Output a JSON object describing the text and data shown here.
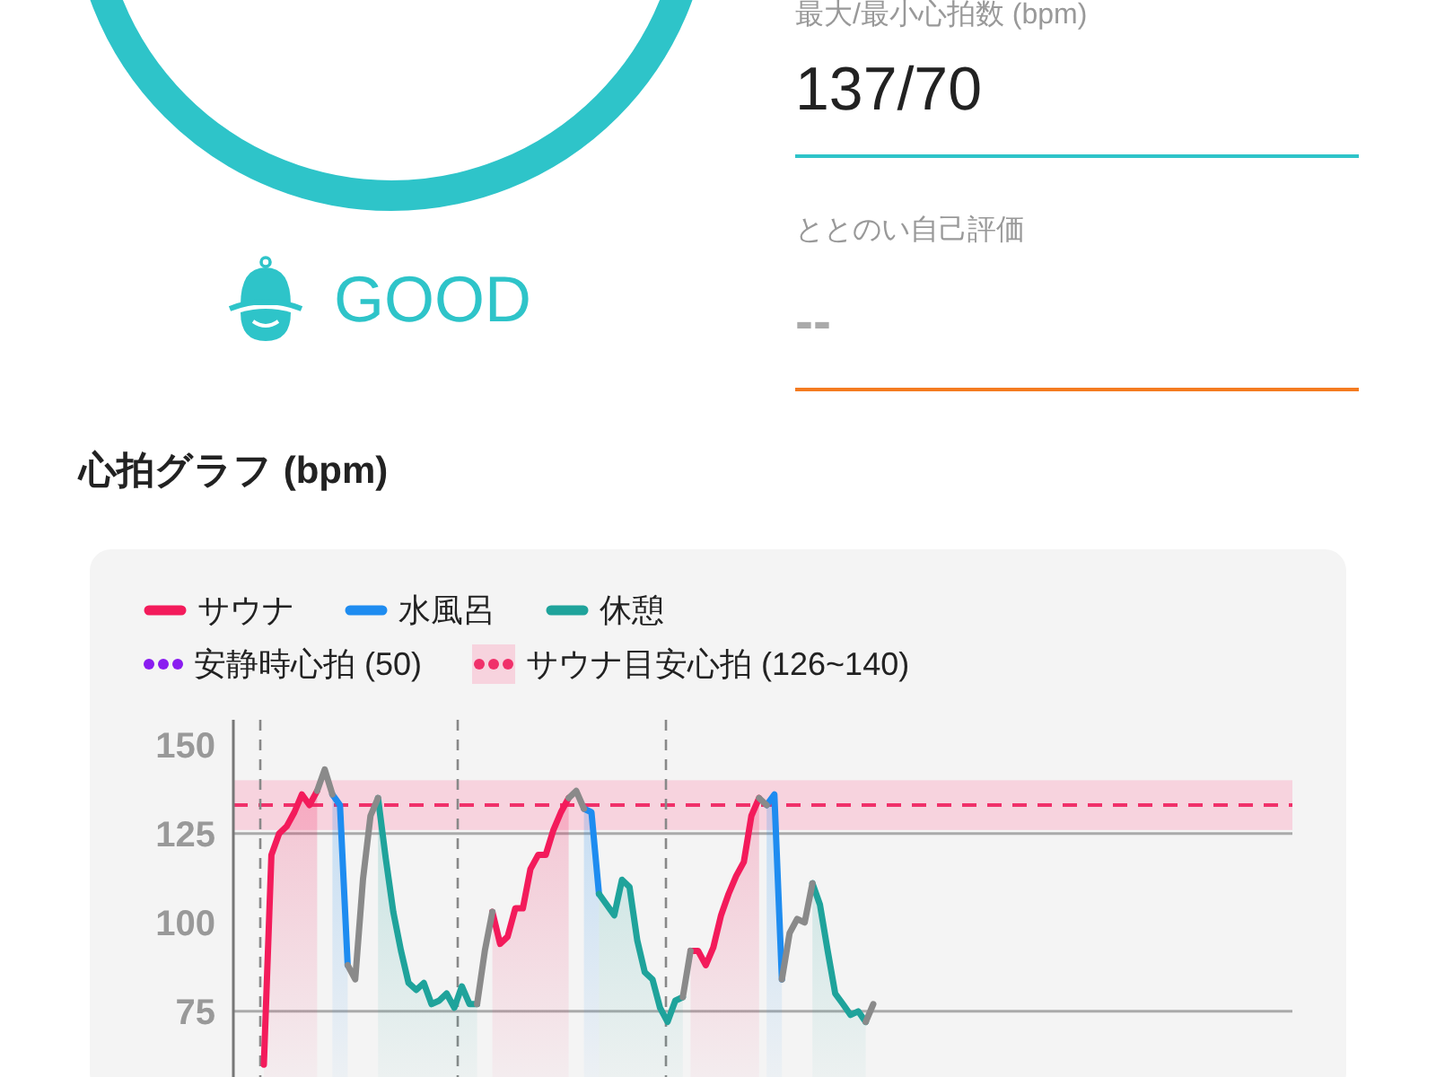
{
  "score": {
    "rating": "GOOD"
  },
  "stats": [
    {
      "label": "最大/最小心拍数 (bpm)",
      "value": "137/70",
      "empty": false,
      "color": "#2ec4c9"
    },
    {
      "label": "ととのい自己評価",
      "value": "--",
      "empty": true,
      "color": "#f47b20"
    }
  ],
  "heart_rate_graph": {
    "title": "心拍グラフ (bpm)",
    "legend": [
      {
        "label": "サウナ",
        "kind": "line",
        "color": "#f31b5b"
      },
      {
        "label": "水風呂",
        "kind": "line",
        "color": "#1e8cf0"
      },
      {
        "label": "休憩",
        "kind": "line",
        "color": "#1fa39b"
      },
      {
        "label": "安静時心拍 (50)",
        "kind": "dots",
        "color": "#8a1cf0"
      },
      {
        "label": "サウナ目安心拍 (126~140)",
        "kind": "band",
        "color": "#f0306a"
      }
    ],
    "chart_data": {
      "type": "area",
      "categories": [
        null,
        null,
        null,
        null,
        null,
        null,
        null,
        null,
        null,
        null,
        null,
        null,
        null,
        null,
        null,
        null,
        null,
        null,
        null,
        null,
        null,
        null,
        null,
        null,
        null,
        null,
        null,
        null,
        null,
        null,
        null,
        null,
        null,
        null,
        null,
        null,
        null,
        null,
        null,
        null,
        null,
        null,
        null,
        null,
        null,
        null,
        null,
        null,
        null,
        null,
        null,
        null,
        null,
        null,
        null,
        null,
        null,
        null,
        null,
        null,
        null,
        null,
        null,
        null,
        null,
        null,
        null,
        null,
        null,
        null,
        null,
        null,
        null,
        null,
        null,
        null,
        null,
        null,
        null,
        null,
        null,
        null,
        null,
        null,
        null,
        null,
        null,
        null,
        null,
        null,
        null,
        null,
        null,
        null,
        null,
        null,
        null,
        null,
        null,
        null,
        null,
        null,
        null,
        null,
        null,
        null,
        null,
        null,
        null,
        null,
        null,
        null,
        null,
        null,
        null,
        null,
        null,
        null,
        null,
        null,
        null,
        null,
        null,
        null,
        null,
        null,
        null,
        null,
        null,
        null,
        null,
        null,
        null,
        null,
        null,
        null,
        null,
        null,
        null,
        null
      ],
      "series": [
        {
          "color": "#f31b5b",
          "values": [
            null,
            null,
            null,
            null,
            60,
            119,
            125,
            127,
            131,
            136,
            133,
            137,
            null,
            null,
            null,
            null,
            null,
            null,
            null,
            null,
            null,
            null,
            null,
            null,
            null,
            null,
            null,
            null,
            null,
            null,
            null,
            null,
            null,
            null,
            103,
            94,
            96,
            104,
            104,
            115,
            119,
            119,
            126,
            131,
            135,
            null,
            null,
            null,
            null,
            null,
            null,
            null,
            null,
            null,
            null,
            null,
            null,
            null,
            null,
            null,
            92,
            92,
            88,
            93,
            102,
            108,
            113,
            117,
            130,
            135,
            null,
            null,
            null,
            null,
            null,
            null,
            null,
            null,
            null,
            null,
            null,
            null,
            null,
            null,
            null,
            null,
            null,
            null,
            null,
            null,
            null,
            null,
            null,
            null,
            null,
            null,
            null,
            null,
            null,
            null,
            null,
            null,
            null,
            null,
            null,
            null,
            null,
            null,
            null,
            null,
            null,
            null,
            null,
            null,
            null,
            null,
            null,
            null,
            null,
            null,
            null,
            null,
            null,
            null,
            null,
            null,
            null,
            null,
            null,
            null,
            null,
            null,
            null,
            null,
            null,
            null,
            null,
            null,
            null,
            null
          ]
        },
        {
          "color": "#1e8cf0",
          "values": [
            null,
            null,
            null,
            null,
            null,
            null,
            null,
            null,
            null,
            null,
            null,
            null,
            null,
            136,
            133,
            88,
            null,
            null,
            null,
            null,
            null,
            null,
            null,
            null,
            null,
            null,
            null,
            null,
            null,
            null,
            null,
            null,
            null,
            null,
            null,
            null,
            null,
            null,
            null,
            null,
            null,
            null,
            null,
            null,
            null,
            null,
            132,
            131,
            108,
            null,
            null,
            null,
            null,
            null,
            null,
            null,
            null,
            null,
            null,
            null,
            null,
            null,
            null,
            null,
            null,
            null,
            null,
            null,
            null,
            null,
            133,
            136,
            84,
            null,
            null,
            null,
            null,
            null,
            null,
            null,
            null,
            null,
            null,
            null,
            null,
            null,
            null,
            null,
            null,
            null,
            null,
            null,
            null,
            null,
            null,
            null,
            null,
            null,
            null,
            null,
            null,
            null,
            null,
            null,
            null,
            null,
            null,
            null,
            null,
            null,
            null,
            null,
            null,
            null,
            null,
            null,
            null,
            null,
            null,
            null,
            null,
            null,
            null,
            null,
            null,
            null,
            null,
            null,
            null,
            null,
            null,
            null,
            null,
            null,
            null,
            null,
            null,
            null,
            null,
            null
          ]
        },
        {
          "color": "#1fa39b",
          "values": [
            null,
            null,
            null,
            null,
            null,
            null,
            null,
            null,
            null,
            null,
            null,
            null,
            null,
            null,
            null,
            null,
            null,
            null,
            null,
            135,
            118,
            103,
            92,
            83,
            81,
            83,
            77,
            78,
            80,
            76,
            82,
            77,
            77,
            null,
            null,
            null,
            null,
            null,
            null,
            null,
            null,
            null,
            null,
            null,
            null,
            null,
            null,
            null,
            108,
            105,
            102,
            112,
            110,
            95,
            86,
            84,
            76,
            72,
            78,
            79,
            null,
            null,
            null,
            null,
            null,
            null,
            null,
            null,
            null,
            null,
            null,
            null,
            null,
            null,
            null,
            null,
            111,
            105,
            92,
            80,
            77,
            74,
            75,
            72,
            null,
            null,
            null,
            null,
            null,
            null,
            null,
            null,
            null,
            null,
            null,
            null,
            null,
            null,
            null,
            null,
            null,
            null,
            null,
            null,
            null,
            null,
            null,
            null,
            null,
            null,
            null,
            null,
            null,
            null,
            null,
            null,
            null,
            null,
            null,
            null,
            null,
            null,
            null,
            null,
            null,
            null,
            null,
            null,
            null,
            null,
            null,
            null,
            null,
            null,
            null,
            null,
            null,
            null,
            null,
            null
          ]
        },
        {
          "color": "#8a8a8a",
          "type": "line",
          "values": [
            null,
            null,
            null,
            null,
            null,
            null,
            null,
            null,
            null,
            null,
            null,
            137,
            143,
            136,
            null,
            88,
            84,
            112,
            130,
            135,
            null,
            null,
            null,
            null,
            null,
            null,
            null,
            null,
            null,
            null,
            null,
            null,
            77,
            92,
            103,
            null,
            null,
            null,
            null,
            null,
            null,
            null,
            null,
            null,
            135,
            137,
            132,
            null,
            null,
            null,
            null,
            null,
            null,
            null,
            null,
            null,
            null,
            null,
            null,
            79,
            92,
            null,
            null,
            null,
            null,
            null,
            null,
            null,
            null,
            135,
            133,
            null,
            84,
            97,
            101,
            100,
            111,
            null,
            null,
            null,
            null,
            null,
            null,
            72,
            77,
            null,
            null,
            null,
            null,
            null,
            null,
            null,
            null,
            null,
            null,
            null,
            null,
            null,
            null,
            null,
            null,
            null,
            null,
            null,
            null,
            null,
            null,
            null,
            null,
            null,
            null,
            null,
            null,
            null,
            null,
            null,
            null,
            null,
            null,
            null,
            null,
            null,
            null,
            null,
            null,
            null,
            null,
            null,
            null,
            null,
            null,
            null,
            null,
            null,
            null,
            null,
            null,
            null,
            null,
            null
          ]
        }
      ],
      "ylim": [
        54,
        157
      ],
      "yticks": [
        75,
        100,
        125,
        150
      ]
    }
  }
}
